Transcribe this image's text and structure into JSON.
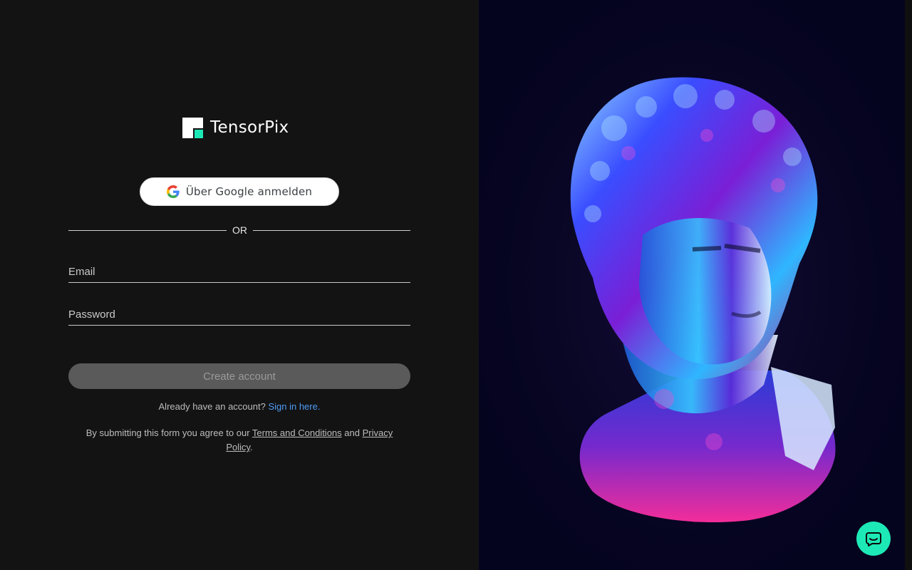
{
  "brand": {
    "name": "TensorPix",
    "accent": "#1de9b6"
  },
  "google": {
    "label": "Über Google anmelden",
    "icon": "google-g-icon"
  },
  "divider": {
    "text": "OR"
  },
  "form": {
    "email_placeholder": "Email",
    "password_placeholder": "Password",
    "submit_label": "Create account"
  },
  "signin": {
    "prompt": "Already have an account?",
    "link": "Sign in here."
  },
  "legal": {
    "prefix": "By submitting this form you agree to our",
    "terms": "Terms and Conditions",
    "and": "and",
    "privacy": "Privacy Policy",
    "suffix": "."
  },
  "hero": {
    "image": "chrome-statue-bust-image"
  },
  "chat": {
    "icon": "chat-bubble-icon"
  }
}
